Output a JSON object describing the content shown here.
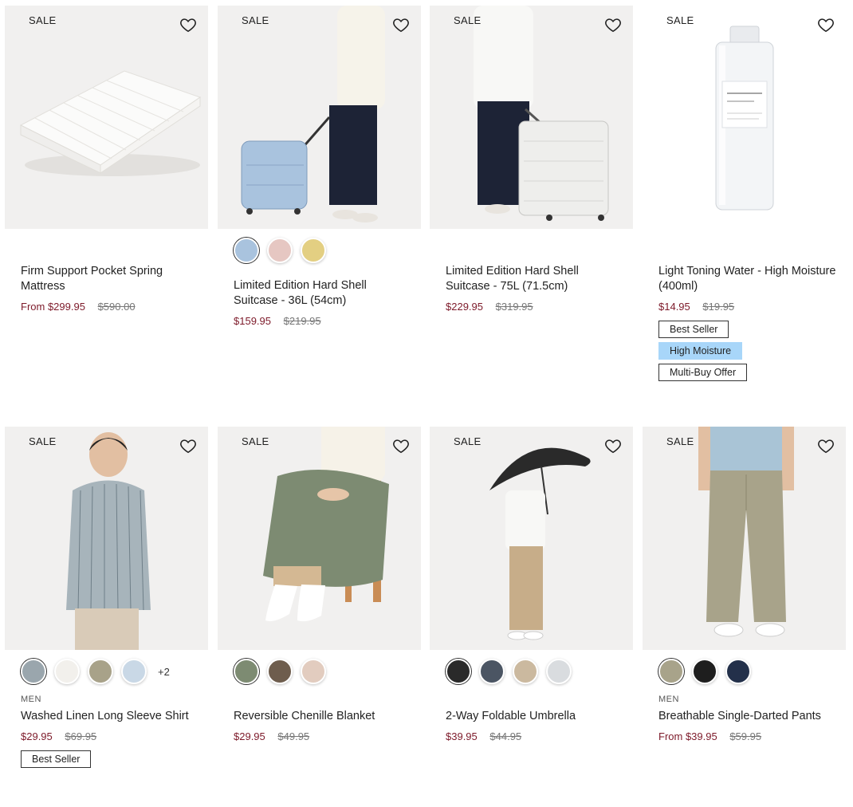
{
  "products": [
    {
      "sale_label": "SALE",
      "image_icon": "mattress-image",
      "swatches": [],
      "category": "",
      "name": "Firm Support Pocket Spring Mattress",
      "price": "From $299.95",
      "old_price": "$590.00",
      "badges": []
    },
    {
      "sale_label": "SALE",
      "image_icon": "suitcase-model-image",
      "swatches": [
        "#a9c3de",
        "#e6c7c2",
        "#e3cf82"
      ],
      "category": "",
      "name": "Limited Edition Hard Shell Suitcase - 36L (54cm)",
      "price": "$159.95",
      "old_price": "$219.95",
      "badges": []
    },
    {
      "sale_label": "SALE",
      "image_icon": "suitcase-model-image",
      "swatches": [],
      "category": "",
      "name": "Limited Edition Hard Shell Suitcase - 75L (71.5cm)",
      "price": "$229.95",
      "old_price": "$319.95",
      "badges": []
    },
    {
      "sale_label": "SALE",
      "image_icon": "toning-water-bottle-image",
      "swatches": [],
      "category": "",
      "name": "Light Toning Water - High Moisture (400ml)",
      "price": "$14.95",
      "old_price": "$19.95",
      "badges": [
        {
          "label": "Best Seller",
          "style": "outline"
        },
        {
          "label": "High Moisture",
          "style": "blue"
        },
        {
          "label": "Multi-Buy Offer",
          "style": "outline"
        }
      ]
    },
    {
      "sale_label": "SALE",
      "image_icon": "linen-shirt-model-image",
      "swatches": [
        "#9aa6ad",
        "#f2f0ec",
        "#a8a289",
        "#c9d8e6"
      ],
      "more_colors": "+2",
      "category": "MEN",
      "name": "Washed Linen Long Sleeve Shirt",
      "price": "$29.95",
      "old_price": "$69.95",
      "badges": [
        {
          "label": "Best Seller",
          "style": "outline"
        }
      ]
    },
    {
      "sale_label": "SALE",
      "image_icon": "chenille-blanket-model-image",
      "swatches": [
        "#7d8b72",
        "#6e5d4d",
        "#e2ccbf"
      ],
      "category": "",
      "name": "Reversible Chenille Blanket",
      "price": "$29.95",
      "old_price": "$49.95",
      "badges": []
    },
    {
      "sale_label": "SALE",
      "image_icon": "umbrella-model-image",
      "swatches": [
        "#2a2a2a",
        "#4b5563",
        "#cbb99f",
        "#d9dcdf"
      ],
      "category": "",
      "name": "2-Way Foldable Umbrella",
      "price": "$39.95",
      "old_price": "$44.95",
      "badges": []
    },
    {
      "sale_label": "SALE",
      "image_icon": "pants-model-image",
      "swatches": [
        "#a8a38a",
        "#1e1e1e",
        "#23304a"
      ],
      "category": "MEN",
      "name": "Breathable Single-Darted Pants",
      "price": "From $39.95",
      "old_price": "$59.95",
      "badges": []
    }
  ],
  "colors": {
    "price": "#7d1a2a",
    "badge_blue": "#a8d6f9",
    "image_bg": "#f1f0ef"
  },
  "icons": {
    "wishlist": "heart-outline-icon"
  }
}
